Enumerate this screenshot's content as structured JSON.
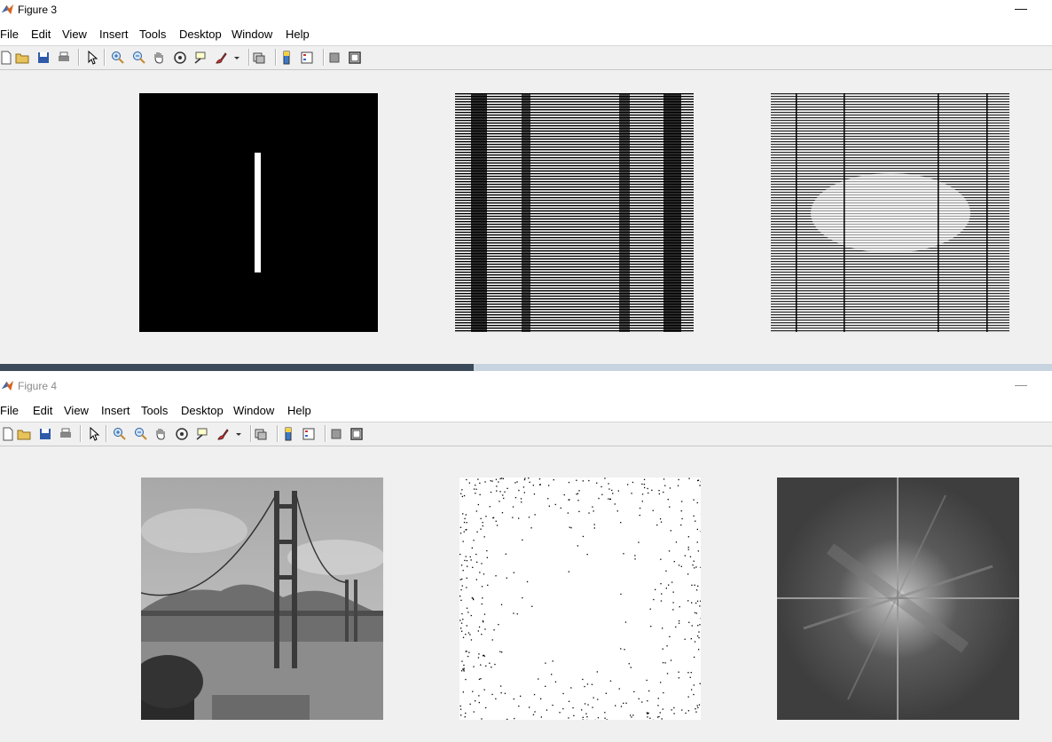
{
  "windows": [
    {
      "title": "Figure 3",
      "active": true,
      "min_label": "—",
      "menu": [
        "File",
        "Edit",
        "View",
        "Insert",
        "Tools",
        "Desktop",
        "Window",
        "Help"
      ],
      "images": [
        "line-bar-image",
        "horizontal-stripes-image",
        "gray-stripes-image"
      ]
    },
    {
      "title": "Figure 4",
      "active": false,
      "min_label": "—",
      "menu": [
        "File",
        "Edit",
        "View",
        "Insert",
        "Tools",
        "Desktop",
        "Window",
        "Help"
      ],
      "images": [
        "golden-gate-bridge-image",
        "sparse-dots-image",
        "fourier-spectrum-image"
      ]
    }
  ],
  "toolbar_icons": [
    "new-file-icon",
    "open-folder-icon",
    "save-icon",
    "print-icon",
    "pointer-icon",
    "zoom-in-icon",
    "zoom-out-icon",
    "pan-hand-icon",
    "rotate-3d-icon",
    "data-cursor-icon",
    "brush-icon",
    "dropdown-arrow-icon",
    "link-plot-icon",
    "colorbar-icon",
    "legend-icon",
    "hide-plot-tools-icon",
    "show-plot-tools-icon"
  ],
  "taskbar_progress": 0.45,
  "colors": {
    "window_bg": "#f0f0f0",
    "bar": "#ffffff",
    "progress": "#3b4a5a"
  }
}
